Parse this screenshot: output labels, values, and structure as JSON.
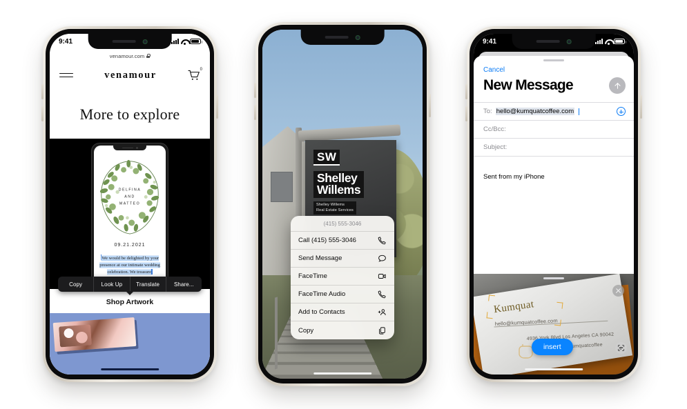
{
  "meta": {
    "background": "#ffffff",
    "accent_blue": "#0a84ff",
    "ios_link_blue": "#0a7bf5"
  },
  "phone1": {
    "status": {
      "time": "9:41",
      "signal_icon": "cellular-bars-icon",
      "wifi_icon": "wifi-icon",
      "battery_icon": "battery-icon"
    },
    "browser": {
      "url": "venamour.com",
      "lock_icon": "lock-icon"
    },
    "nav": {
      "menu_icon": "hamburger-menu-icon",
      "logo": "venamour",
      "cart_icon": "shopping-cart-icon",
      "cart_count": "0"
    },
    "hero_heading": "More to explore",
    "invitation": {
      "names": [
        "DELFINA",
        "AND",
        "MATTEO"
      ],
      "date": "09.21.2021",
      "body_text": "We would be delighted by your presence at our intimate wedding celebration. We treasure"
    },
    "selection_menu": {
      "items": [
        "Copy",
        "Look Up",
        "Translate",
        "Share..."
      ]
    },
    "shop_heading": "Shop Artwork"
  },
  "phone2": {
    "sign": {
      "monogram": "SW",
      "name_line1": "Shelley",
      "name_line2": "Willems",
      "sub_line1": "Shelley Willems",
      "sub_line2": "Real Estate Services",
      "phone": "(415) 555-3046"
    },
    "context_menu": {
      "header": "(415) 555-3046",
      "items": [
        {
          "label": "Call (415) 555-3046",
          "icon": "phone-icon"
        },
        {
          "label": "Send Message",
          "icon": "message-bubble-icon"
        },
        {
          "label": "FaceTime",
          "icon": "video-camera-icon"
        },
        {
          "label": "FaceTime Audio",
          "icon": "phone-icon"
        },
        {
          "label": "Add to Contacts",
          "icon": "add-person-icon"
        },
        {
          "label": "Copy",
          "icon": "copy-icon"
        }
      ]
    }
  },
  "phone3": {
    "status": {
      "time": "9:41",
      "privacy_dot": "green-privacy-indicator",
      "signal_icon": "cellular-bars-icon",
      "wifi_icon": "wifi-icon",
      "battery_icon": "battery-icon"
    },
    "compose": {
      "cancel_label": "Cancel",
      "title": "New Message",
      "send_icon": "send-arrow-up-icon",
      "to_label": "To:",
      "to_value": "hello@kumquatcoffee.com",
      "add_contact_icon": "add-contact-plus-icon",
      "cc_label": "Cc/Bcc:",
      "subject_label": "Subject:",
      "signature": "Sent from my iPhone"
    },
    "scanner": {
      "close_icon": "close-x-icon",
      "scan_text_icon": "live-text-scan-icon",
      "insert_label": "insert",
      "business_card": {
        "brand": "Kumquat",
        "email": "hello@kumquatcoffee.com",
        "address": "4936 York Blvd Los Angeles CA 90042",
        "handle": "@kumquatcoffee"
      }
    }
  }
}
